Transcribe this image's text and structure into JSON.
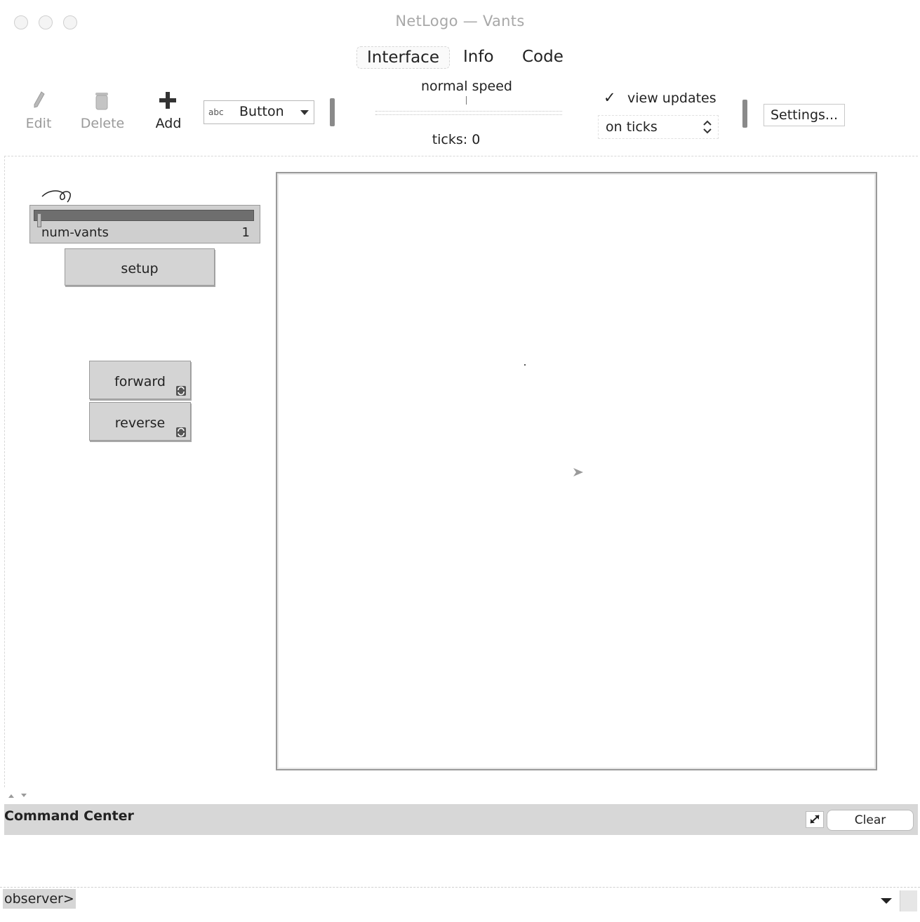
{
  "window": {
    "title": "NetLogo — Vants"
  },
  "tabs": [
    {
      "label": "Interface",
      "active": true
    },
    {
      "label": "Info",
      "active": false
    },
    {
      "label": "Code",
      "active": false
    }
  ],
  "toolbar": {
    "edit_label": "Edit",
    "delete_label": "Delete",
    "add_label": "Add",
    "widget_type": {
      "icon": "abc",
      "label": "Button"
    },
    "speed_label": "normal speed",
    "ticks_text": "ticks: 0",
    "view_updates_check": "✓",
    "view_updates_label": "view updates",
    "update_mode": "on ticks",
    "settings_label": "Settings..."
  },
  "widgets": {
    "slider": {
      "name": "num-vants",
      "value": "1",
      "fill_fraction": 0.0
    },
    "setup_label": "setup",
    "forward_label": "forward",
    "reverse_label": "reverse"
  },
  "command_center": {
    "title": "Command Center",
    "clear_label": "Clear",
    "prompt": "observer>",
    "input_value": ""
  },
  "colors": {
    "panel_gray": "#d4d4d4",
    "slider_track": "#6e6e6e",
    "title_gray": "#a8a8a8",
    "header_gray": "#d7d7d7"
  }
}
